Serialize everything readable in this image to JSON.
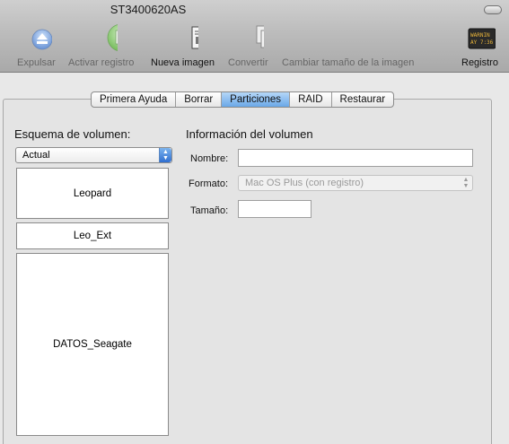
{
  "window": {
    "title": "ST3400620AS"
  },
  "toolbar": {
    "items": [
      {
        "label": "Expulsar",
        "icon": "eject-icon"
      },
      {
        "label": "Activar registro",
        "icon": "journal-icon"
      },
      {
        "label": "Nueva imagen",
        "icon": "new-image-icon"
      },
      {
        "label": "Convertir",
        "icon": "convert-icon"
      },
      {
        "label": "Cambiar tamaño de la imagen",
        "icon": "resize-image-icon"
      },
      {
        "label": "Registro",
        "icon": "log-icon"
      }
    ],
    "log_icon_text": [
      "WARNIN",
      "AY 7:36"
    ]
  },
  "tabs": [
    {
      "label": "Primera Ayuda",
      "selected": false
    },
    {
      "label": "Borrar",
      "selected": false
    },
    {
      "label": "Particiones",
      "selected": true
    },
    {
      "label": "RAID",
      "selected": false
    },
    {
      "label": "Restaurar",
      "selected": false
    }
  ],
  "volume_scheme": {
    "title": "Esquema de volumen:",
    "selected": "Actual",
    "partitions": [
      "Leopard",
      "Leo_Ext",
      "DATOS_Seagate"
    ]
  },
  "volume_info": {
    "title": "Información del volumen",
    "name_label": "Nombre:",
    "name_value": "",
    "format_label": "Formato:",
    "format_value": "Mac OS Plus (con registro)",
    "size_label": "Tamaño:",
    "size_value": ""
  }
}
